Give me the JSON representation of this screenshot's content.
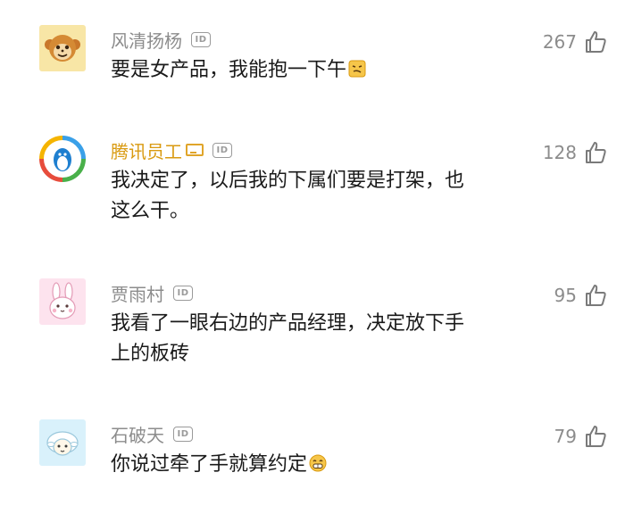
{
  "comments": [
    {
      "user": "风清扬杨",
      "text": "要是女产品，我能抱一下午",
      "likes": "267",
      "avatar": "monkey-avatar",
      "emoji": "sly-face-emoji"
    },
    {
      "user": "腾讯员工",
      "text_line1": "我决定了，以后我的下属们要是打架，也",
      "text_line2": "这么干。",
      "likes": "128",
      "avatar": "qq-penguin-avatar"
    },
    {
      "user": "贾雨村",
      "text_line1": "我看了一眼右边的产品经理，决定放下手",
      "text_line2": "上的板砖",
      "likes": "95",
      "avatar": "rabbit-avatar"
    },
    {
      "user": "石破天",
      "text": "你说过牵了手就算约定",
      "likes": "79",
      "avatar": "sheep-avatar",
      "emoji": "grin-emoji"
    }
  ],
  "id_badge_label": "ID",
  "colors": {
    "username": "#8c8c8c",
    "staff_username": "#d99a10",
    "text": "#1a1a1a"
  }
}
